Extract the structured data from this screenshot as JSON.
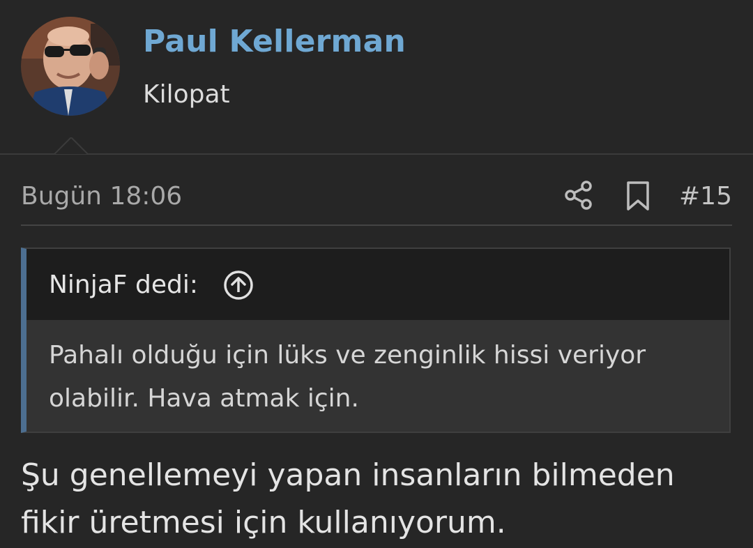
{
  "user": {
    "name": "Paul Kellerman",
    "title": "Kilopat",
    "avatar_icon": "user-photo-avatar"
  },
  "post": {
    "date": "Bugün 18:06",
    "number": "#15",
    "share_icon": "share-icon",
    "bookmark_icon": "bookmark-icon"
  },
  "quote": {
    "author_line": "NinjaF dedi:",
    "jump_icon": "circle-arrow-up-icon",
    "text": "Pahalı olduğu için lüks ve zenginlik hissi veriyor olabilir. Hava atmak için."
  },
  "message": {
    "text": "Şu genellemeyi yapan insanların bilmeden fikir üretmesi için kullanıyorum."
  },
  "colors": {
    "background": "#262626",
    "username": "#6fa8d3",
    "quote_accent": "#4d6f91",
    "quote_header": "#1d1d1d",
    "quote_body": "#333333"
  }
}
